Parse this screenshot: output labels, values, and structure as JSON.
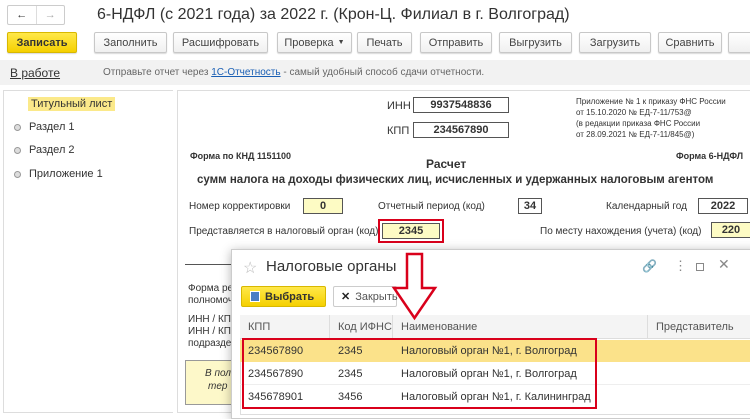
{
  "window": {
    "title": "6-НДФЛ (с 2021 года) за 2022 г. (Крон-Ц. Филиал в г. Волгоград)"
  },
  "nav": {
    "back": "←",
    "forward": "→"
  },
  "toolbar": [
    "Записать",
    "Заполнить",
    "Расшифровать",
    "Проверка",
    "Печать",
    "Отправить",
    "Выгрузить",
    "Загрузить",
    "Сравнить"
  ],
  "infobar": {
    "status": "В работе",
    "text_before": "Отправьте отчет через ",
    "link": "1С-Отчетность",
    "text_after": " - самый удобный способ сдачи отчетности."
  },
  "sidebar": {
    "items": [
      {
        "label": "Титульный лист",
        "active": true
      },
      {
        "label": "Раздел 1"
      },
      {
        "label": "Раздел 2"
      },
      {
        "label": "Приложение 1"
      }
    ]
  },
  "form": {
    "inn_label": "ИНН",
    "inn": "9937548836",
    "kpp_label": "КПП",
    "kpp": "234567890",
    "appendix": [
      "Приложение № 1 к приказу ФНС России",
      "от 15.10.2020 № ЕД-7-11/753@",
      "(в редакции приказа ФНС России",
      "от 28.09.2021 № ЕД-7-11/845@)"
    ],
    "knd": "Форма по КНД 1151100",
    "form_name": "Форма 6-НДФЛ",
    "title": "Расчет",
    "subtitle": "сумм налога на доходы физических лиц, исчисленных и удержанных налоговым агентом",
    "correction_label": "Номер корректировки",
    "correction": "0",
    "period_label": "Отчетный период (код)",
    "period": "34",
    "year_label": "Календарный год",
    "year": "2022",
    "tax_office_label": "Представляется в налоговый орган (код)",
    "tax_office": "2345",
    "location_label": "По месту нахождения (учета) (код)",
    "location": "220",
    "partial": [
      "Форма ре",
      "полномоч",
      "ИНН / КП",
      "ИНН / КП",
      "подразде",
      "В пол",
      "тер"
    ]
  },
  "dialog": {
    "title": "Налоговые органы",
    "select": "Выбрать",
    "close": "Закрыть",
    "columns": [
      "КПП",
      "Код ИФНС",
      "Наименование",
      "Представитель"
    ],
    "rows": [
      [
        "234567890",
        "2345",
        "Налоговый орган №1, г. Волгоград"
      ],
      [
        "234567890",
        "2345",
        "Налоговый орган №1, г. Волгоград"
      ],
      [
        "345678901",
        "3456",
        "Налоговый орган №1, г. Калининград"
      ]
    ]
  },
  "colors": {
    "accent": "#f5d000",
    "highlight": "#fbe28a",
    "annotation": "#d9001b",
    "link": "#1a5fb4"
  }
}
